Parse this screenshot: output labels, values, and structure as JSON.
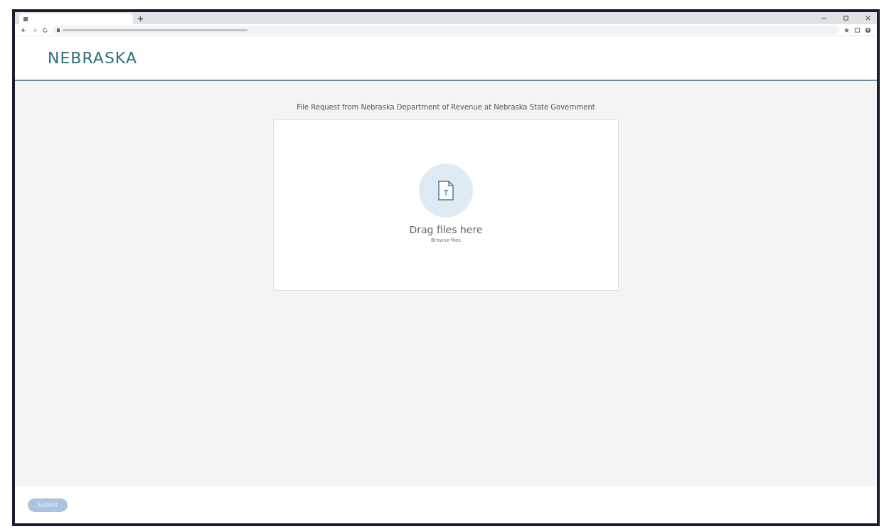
{
  "header": {
    "logo": "NEBRASKA"
  },
  "request": {
    "title": "File Request from Nebraska Department of Revenue at Nebraska State Government",
    "drop_label": "Drag files here",
    "browse_link": "Browse files"
  },
  "footer": {
    "submit": {
      "label": "Submit",
      "disabled": true
    }
  }
}
